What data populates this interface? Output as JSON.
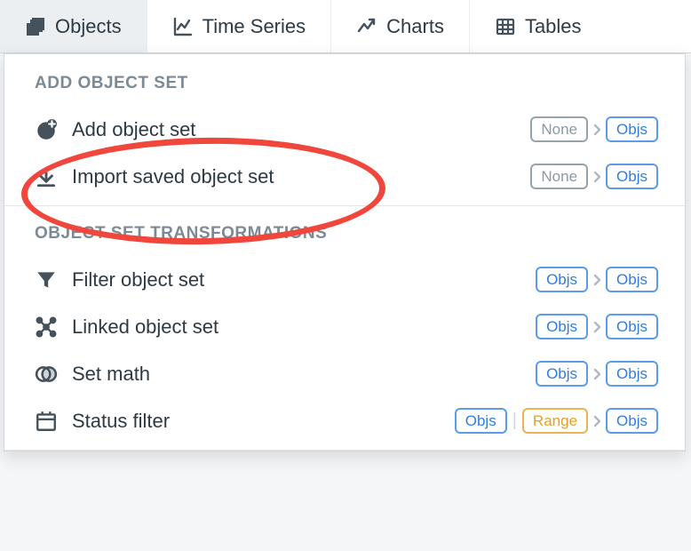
{
  "tabs": [
    {
      "label": "Objects"
    },
    {
      "label": "Time Series"
    },
    {
      "label": "Charts"
    },
    {
      "label": "Tables"
    }
  ],
  "sections": [
    {
      "header": "ADD OBJECT SET",
      "items": [
        {
          "label": "Add object set",
          "badges_left": "None",
          "badges_right": "Objs"
        },
        {
          "label": "Import saved object set",
          "badges_left": "None",
          "badges_right": "Objs"
        }
      ]
    },
    {
      "header": "OBJECT SET TRANSFORMATIONS",
      "items": [
        {
          "label": "Filter object set",
          "badges_left": "Objs",
          "badges_right": "Objs"
        },
        {
          "label": "Linked object set",
          "badges_left": "Objs",
          "badges_right": "Objs"
        },
        {
          "label": "Set math",
          "badges_left": "Objs",
          "badges_right": "Objs"
        },
        {
          "label": "Status filter",
          "badges_left": "Objs",
          "badges_mid": "Range",
          "badges_right": "Objs"
        }
      ]
    }
  ]
}
